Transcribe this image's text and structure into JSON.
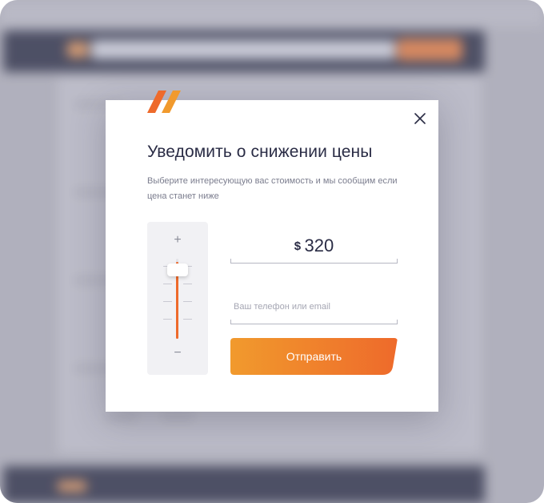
{
  "modal": {
    "title": "Уведомить о снижении цены",
    "subtitle": "Выберите интересующую вас стоимость и мы сообщим если цена станет ниже",
    "price": {
      "currency": "$",
      "value": "320"
    },
    "slider": {
      "plus": "+",
      "minus": "−",
      "level_fraction": 0.96
    },
    "contact": {
      "placeholder": "Ваш телефон или email",
      "value": ""
    },
    "submit_label": "Отправить",
    "close_icon": "close-icon"
  },
  "colors": {
    "accent": "#ee6a2b",
    "accent_light": "#f19a2d",
    "text_dark": "#2a2c45",
    "text_muted": "#7b7d8e",
    "backdrop_header": "#35384f"
  }
}
